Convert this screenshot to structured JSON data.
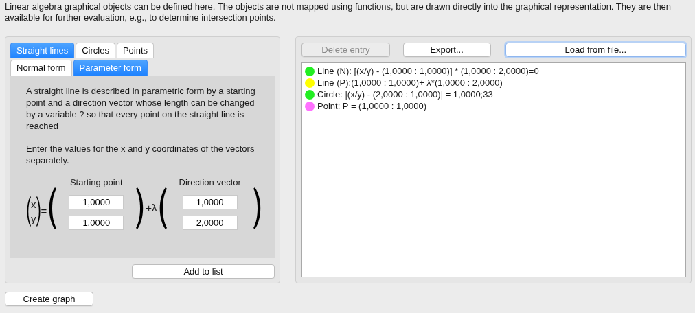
{
  "intro": "Linear algebra graphical objects can be defined here. The objects are not mapped using functions, but are drawn directly into the graphical representation. They are then available for further evaluation, e.g., to determine intersection points.",
  "tabs": [
    {
      "label": "Straight lines",
      "selected": true
    },
    {
      "label": "Circles",
      "selected": false
    },
    {
      "label": "Points",
      "selected": false
    }
  ],
  "subtabs": [
    {
      "label": "Normal form",
      "selected": false
    },
    {
      "label": "Parameter form",
      "selected": true
    }
  ],
  "description": [
    "A straight line is described in parametric form by a starting point and a direction vector whose length can be changed by a variable ? so that every point on the straight line is reached",
    "Enter the values for the x and y coordinates of the vectors separately."
  ],
  "formula": {
    "variables": [
      "x",
      "y"
    ],
    "equals": "=",
    "plus": "+λ",
    "start": {
      "label": "Starting point",
      "values": [
        "1,0000",
        "1,0000"
      ]
    },
    "direction": {
      "label": "Direction vector",
      "values": [
        "1,0000",
        "2,0000"
      ]
    }
  },
  "add_button": "Add to list",
  "toolbar": [
    {
      "label": "Delete entry",
      "disabled": true,
      "focused": false
    },
    {
      "label": "Export...",
      "disabled": false,
      "focused": false
    },
    {
      "label": "Load from file...",
      "disabled": false,
      "focused": true
    }
  ],
  "entries": [
    {
      "text": "Line (N): [(x/y) - (1,0000 : 1,0000)] * (1,0000 : 2,0000)=0",
      "color": "#22ee22"
    },
    {
      "text": "Line (P):(1,0000 : 1,0000)+ λ*(1,0000 : 2,0000)",
      "color": "#ffff00"
    },
    {
      "text": "Circle: |(x/y) - (2,0000 : 1,0000)| = 1,0000;33",
      "color": "#22ee22"
    },
    {
      "text": "Point: P = (1,0000 : 1,0000)",
      "color": "#ff70ff"
    }
  ],
  "create_button": "Create graph"
}
